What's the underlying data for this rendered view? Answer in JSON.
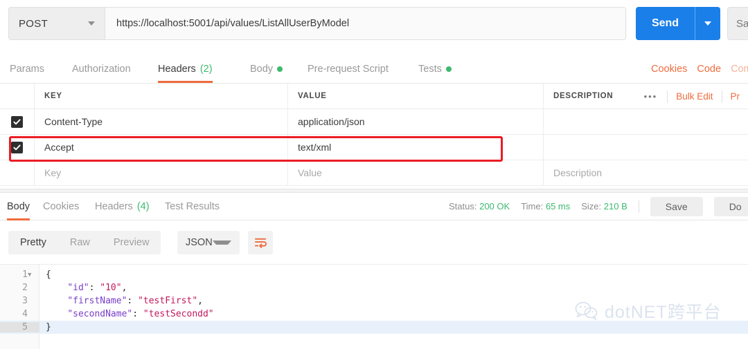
{
  "request": {
    "method": "POST",
    "url": "https://localhost:5001/api/values/ListAllUserByModel",
    "send_label": "Send",
    "save_label": "Sa",
    "tabs": [
      {
        "label": "Params",
        "count": "",
        "dot": false,
        "active": false
      },
      {
        "label": "Authorization",
        "count": "",
        "dot": false,
        "active": false
      },
      {
        "label": "Headers",
        "count": "(2)",
        "dot": false,
        "active": true
      },
      {
        "label": "Body",
        "count": "",
        "dot": true,
        "active": false
      },
      {
        "label": "Pre-request Script",
        "count": "",
        "dot": false,
        "active": false
      },
      {
        "label": "Tests",
        "count": "",
        "dot": true,
        "active": false
      }
    ],
    "right_links": [
      {
        "label": "Cookies",
        "faded": false
      },
      {
        "label": "Code",
        "faded": false
      },
      {
        "label": "Com",
        "faded": true
      }
    ]
  },
  "headers_table": {
    "columns": {
      "key": "KEY",
      "value": "VALUE",
      "description": "DESCRIPTION"
    },
    "tools": {
      "dots": "•••",
      "bulk_edit": "Bulk Edit",
      "presets": "Pr"
    },
    "rows": [
      {
        "checked": true,
        "key": "Content-Type",
        "value": "application/json",
        "description": "",
        "highlighted": false
      },
      {
        "checked": true,
        "key": "Accept",
        "value": "text/xml",
        "description": "",
        "highlighted": true
      }
    ],
    "new_row": {
      "key_placeholder": "Key",
      "value_placeholder": "Value",
      "description_placeholder": "Description"
    }
  },
  "response": {
    "tabs": [
      {
        "label": "Body",
        "count": "",
        "active": true
      },
      {
        "label": "Cookies",
        "count": "",
        "active": false
      },
      {
        "label": "Headers",
        "count": "(4)",
        "active": false
      },
      {
        "label": "Test Results",
        "count": "",
        "active": false
      }
    ],
    "meta": {
      "status_label": "Status:",
      "status_value": "200 OK",
      "time_label": "Time:",
      "time_value": "65 ms",
      "size_label": "Size:",
      "size_value": "210 B"
    },
    "save_label": "Save",
    "download_label": "Do",
    "format_tabs": [
      {
        "label": "Pretty",
        "active": true
      },
      {
        "label": "Raw",
        "active": false
      },
      {
        "label": "Preview",
        "active": false
      }
    ],
    "language": "JSON",
    "body_lines": [
      {
        "num": "1",
        "fold": true,
        "active": false,
        "segments": [
          {
            "t": "{",
            "c": "p"
          }
        ]
      },
      {
        "num": "2",
        "fold": false,
        "active": false,
        "segments": [
          {
            "t": "    ",
            "c": "p"
          },
          {
            "t": "\"id\"",
            "c": "k"
          },
          {
            "t": ": ",
            "c": "p"
          },
          {
            "t": "\"10\"",
            "c": "v"
          },
          {
            "t": ",",
            "c": "p"
          }
        ]
      },
      {
        "num": "3",
        "fold": false,
        "active": false,
        "segments": [
          {
            "t": "    ",
            "c": "p"
          },
          {
            "t": "\"firstName\"",
            "c": "k"
          },
          {
            "t": ": ",
            "c": "p"
          },
          {
            "t": "\"testFirst\"",
            "c": "v"
          },
          {
            "t": ",",
            "c": "p"
          }
        ]
      },
      {
        "num": "4",
        "fold": false,
        "active": false,
        "segments": [
          {
            "t": "    ",
            "c": "p"
          },
          {
            "t": "\"secondName\"",
            "c": "k"
          },
          {
            "t": ": ",
            "c": "p"
          },
          {
            "t": "\"testSecondd\"",
            "c": "v"
          }
        ]
      },
      {
        "num": "5",
        "fold": false,
        "active": true,
        "segments": [
          {
            "t": "}",
            "c": "p"
          }
        ]
      }
    ]
  },
  "watermark": {
    "text": "dotNET跨平台"
  },
  "colors": {
    "accent_orange": "#ef6c3e",
    "send_blue": "#1a7fe8",
    "status_green": "#3dba6f",
    "highlight_red": "#ec1c24"
  }
}
